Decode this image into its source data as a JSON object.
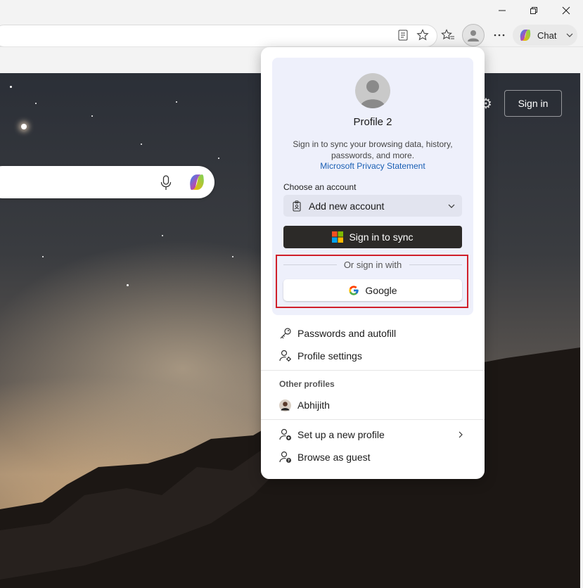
{
  "window": {
    "minimize_icon": "minimize-icon",
    "restore_icon": "restore-icon",
    "close_icon": "close-icon"
  },
  "toolbar": {
    "chat_label": "Chat"
  },
  "page": {
    "signin_label": "Sign in"
  },
  "profile_flyout": {
    "profile_name": "Profile 2",
    "description": "Sign in to sync your browsing data, history, passwords, and more.",
    "privacy_link": "Microsoft Privacy Statement",
    "choose_account_label": "Choose an account",
    "account_selected": "Add new account",
    "sync_button": "Sign in to sync",
    "or_sign_in_with": "Or sign in with",
    "google_button": "Google",
    "menu": {
      "passwords": "Passwords and autofill",
      "profile_settings": "Profile settings",
      "other_profiles_label": "Other profiles",
      "other_profile_name": "Abhijith",
      "new_profile": "Set up a new profile",
      "guest": "Browse as guest"
    }
  },
  "colors": {
    "accent_link": "#1a5fb4",
    "sync_button_bg": "#2c2a28",
    "highlight_box": "#d0202a",
    "card_bg": "#eef0fb"
  }
}
